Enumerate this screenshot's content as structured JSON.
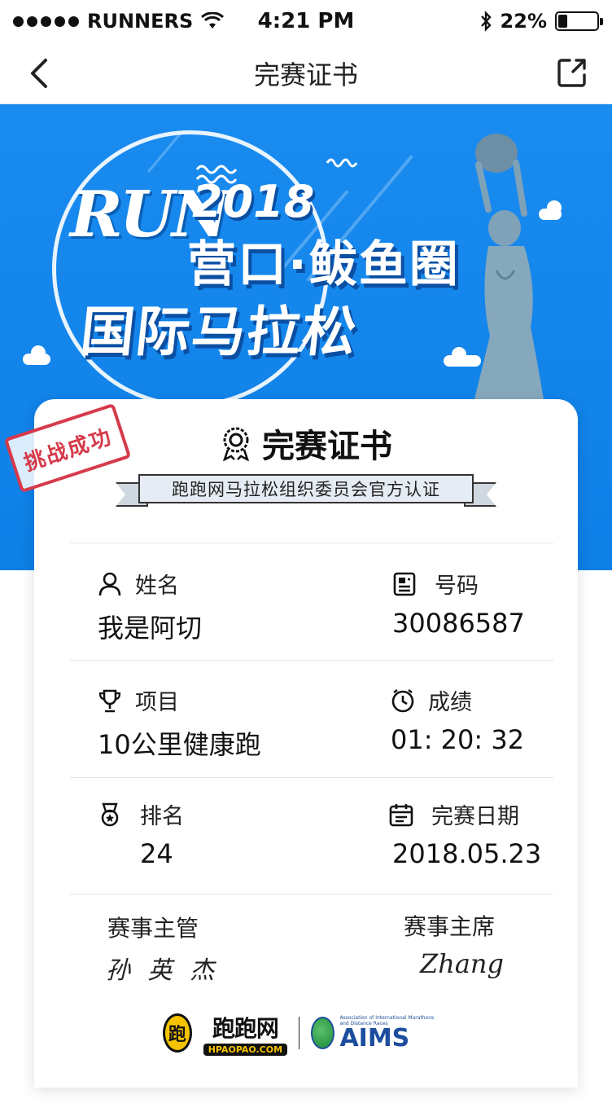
{
  "status_bar": {
    "carrier": "RUNNERS",
    "time": "4:21 PM",
    "battery": "22%",
    "battery_level": 0.22
  },
  "nav": {
    "title": "完赛证书",
    "back_icon": "chevron-left-icon",
    "share_icon": "share-icon"
  },
  "banner": {
    "logo_text": "RUN",
    "year": "2018",
    "title_line1": "营口·鲅鱼圈",
    "title_line2": "国际马拉松"
  },
  "certificate": {
    "stamp": "挑战成功",
    "title": "完赛证书",
    "subtitle": "跑跑网马拉松组织委员会官方认证",
    "fields": {
      "name": {
        "label": "姓名",
        "value": "我是阿切",
        "icon": "user-icon"
      },
      "bib": {
        "label": "号码",
        "value": "30086587",
        "icon": "document-icon"
      },
      "event": {
        "label": "项目",
        "value": "10公里健康跑",
        "icon": "trophy-icon"
      },
      "result": {
        "label": "成绩",
        "value": "01: 20: 32",
        "icon": "clock-icon"
      },
      "rank": {
        "label": "排名",
        "value": "24",
        "icon": "medal-icon"
      },
      "date": {
        "label": "完赛日期",
        "value": "2018.05.23",
        "icon": "calendar-icon"
      }
    },
    "signatures": {
      "left_label": "赛事主管",
      "left_sig": "孙 英 杰",
      "right_label": "赛事主席",
      "right_sig": "Zhang"
    },
    "logos": {
      "hp_badge": "跑",
      "hp_name": "跑跑网",
      "hp_domain": "HPAOPAO.COM",
      "aims_small": "Association of International Marathons and Distance Races",
      "aims_name": "AIMS"
    }
  },
  "colors": {
    "banner_blue": "#1a8cf0",
    "stamp_red": "#d63a4a",
    "aims_blue": "#1d4e9e",
    "hp_yellow": "#f5c300"
  }
}
